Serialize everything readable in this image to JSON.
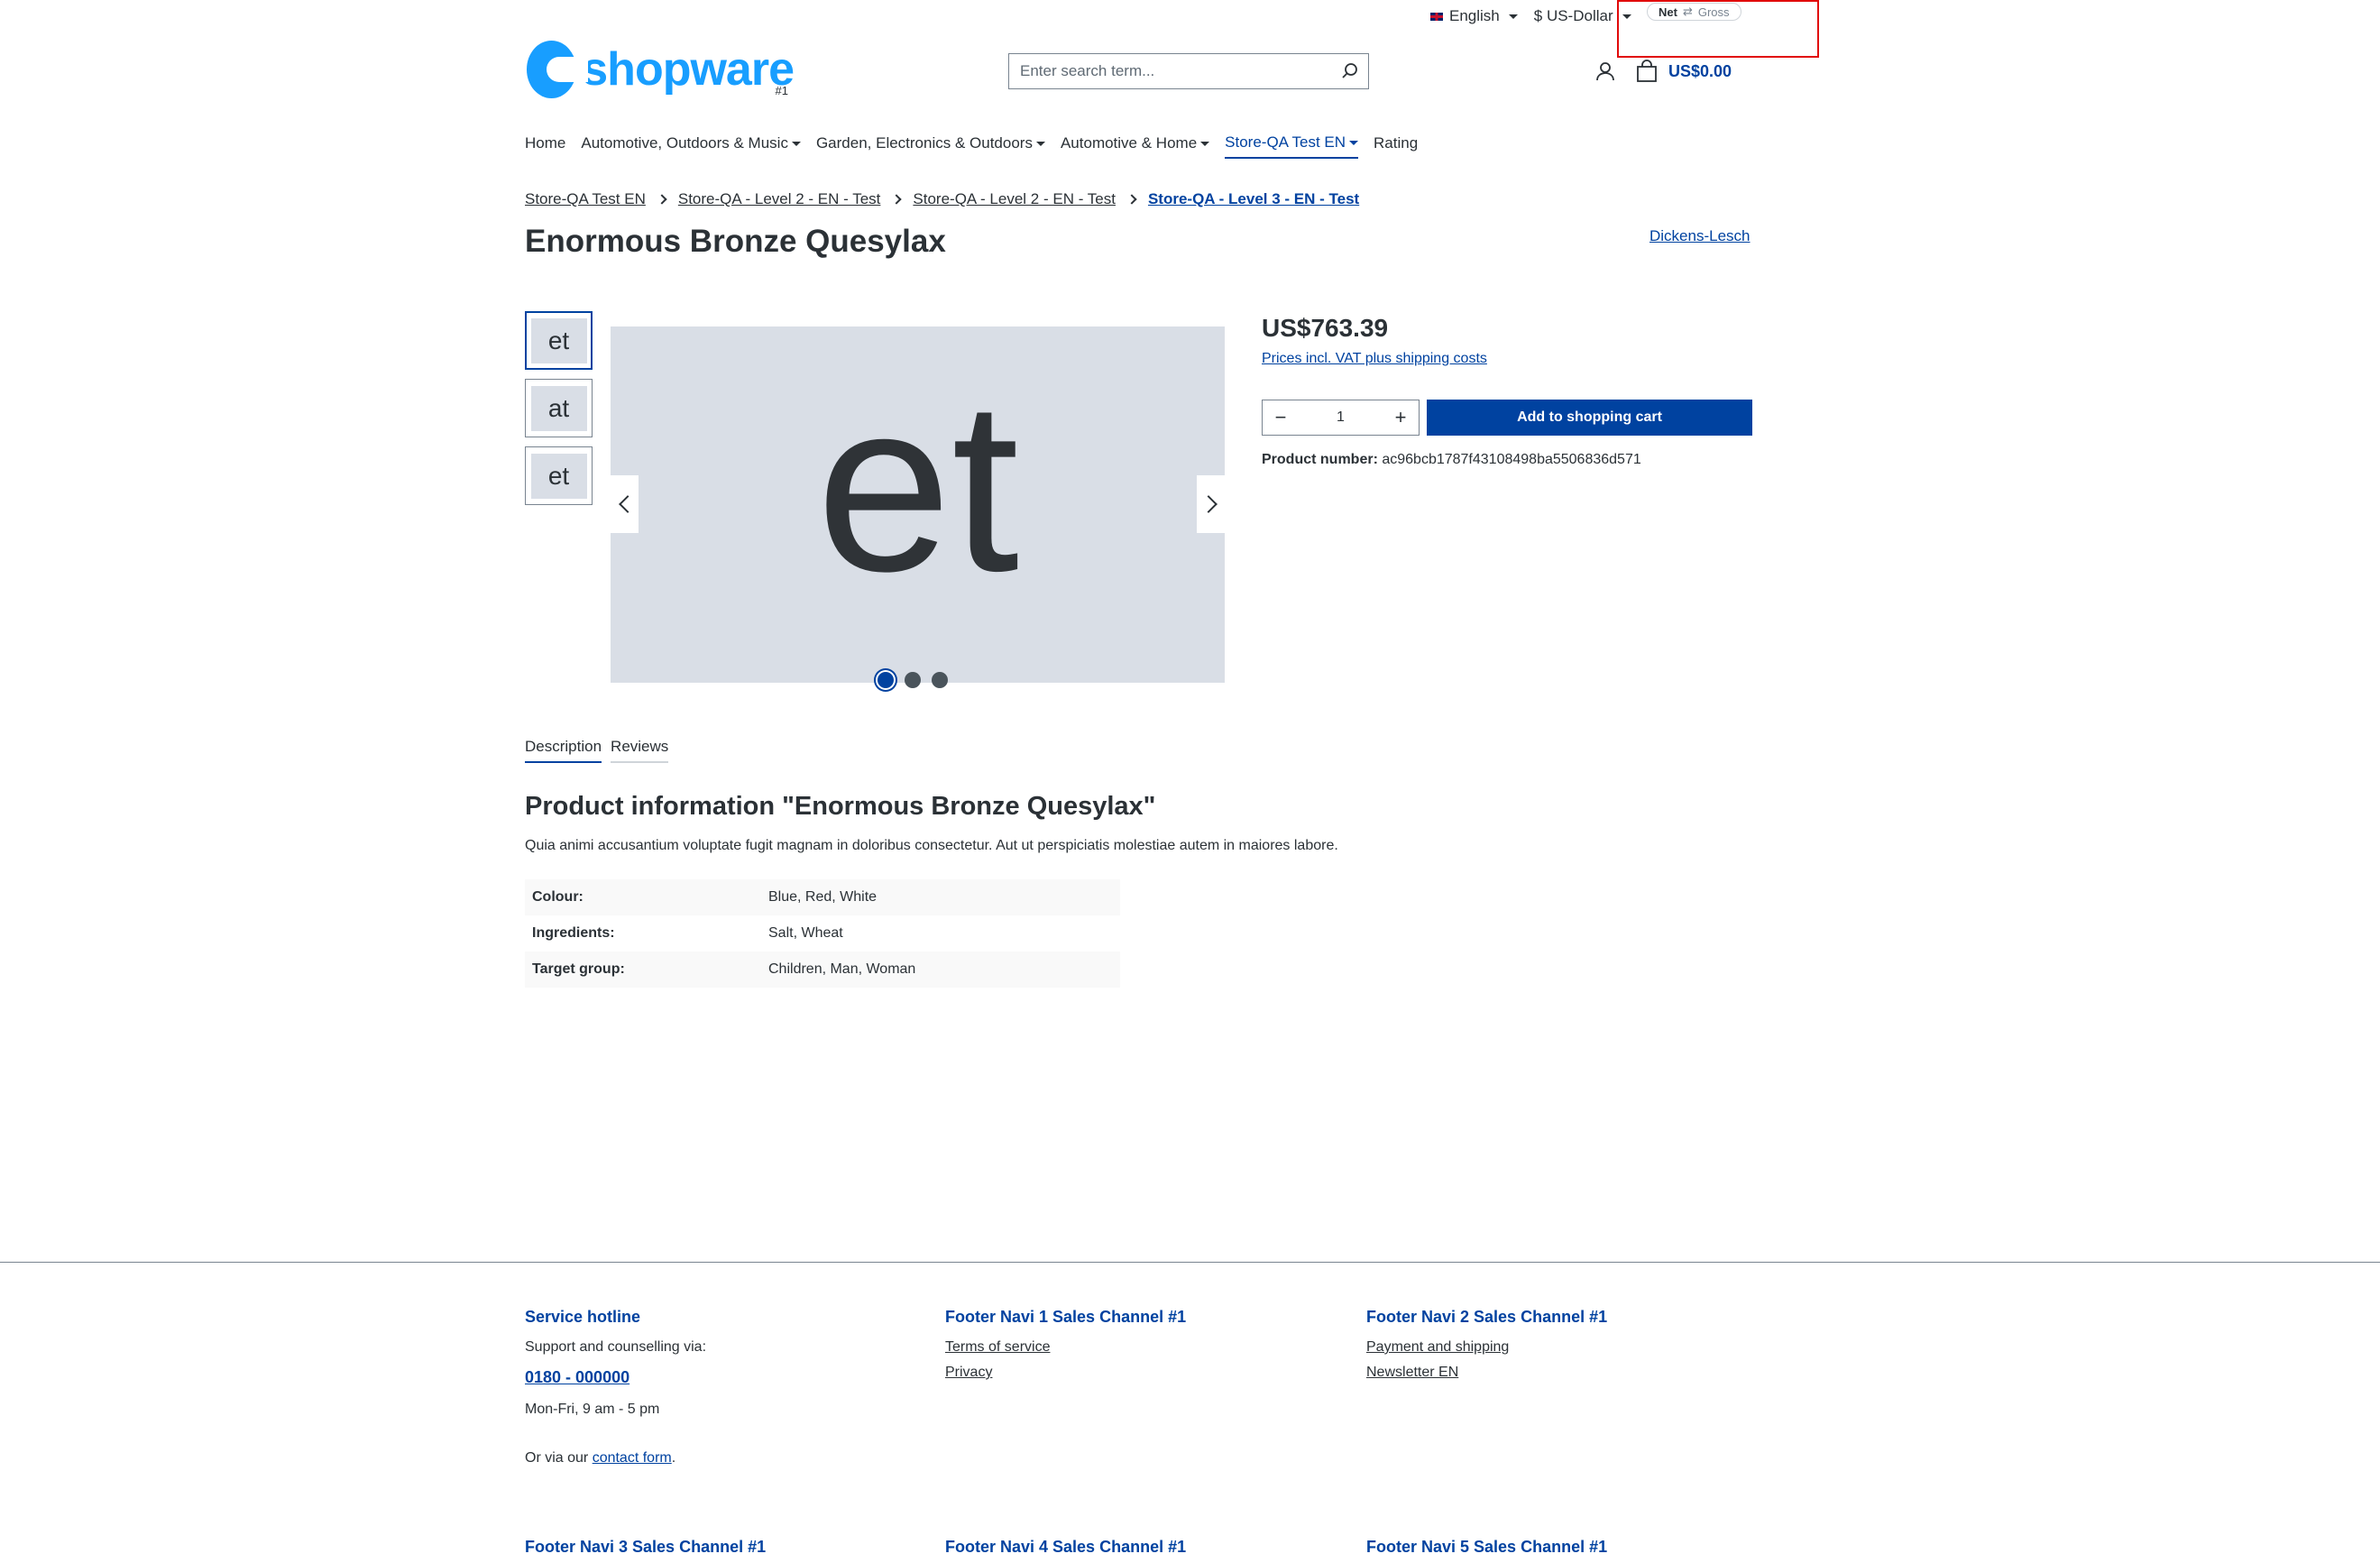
{
  "topbar": {
    "language": "English",
    "currency": "$ US-Dollar",
    "net_label": "Net",
    "gross_label": "Gross",
    "switch_glyph": "⇄"
  },
  "header": {
    "logo_text": "shopware",
    "logo_sub": "#1",
    "search_placeholder": "Enter search term...",
    "cart_amount": "US$0.00"
  },
  "nav": {
    "items": [
      {
        "label": "Home"
      },
      {
        "label": "Automotive, Outdoors & Music"
      },
      {
        "label": "Garden, Electronics & Outdoors"
      },
      {
        "label": "Automotive & Home"
      },
      {
        "label": "Store-QA Test EN"
      },
      {
        "label": "Rating"
      }
    ]
  },
  "breadcrumb": [
    "Store-QA Test EN",
    "Store-QA - Level 2 - EN - Test",
    "Store-QA - Level 2 - EN - Test",
    "Store-QA - Level 3 - EN - Test"
  ],
  "product": {
    "title": "Enormous Bronze Quesylax",
    "manufacturer": "Dickens-Lesch",
    "thumbnails": [
      "et",
      "at",
      "et"
    ],
    "main_image_text": "et",
    "price": "US$763.39",
    "vat_note": "Prices incl. VAT plus shipping costs",
    "quantity": "1",
    "add_to_cart": "Add to shopping cart",
    "number_label": "Product number:",
    "number_value": "ac96bcb1787f43108498ba5506836d571"
  },
  "tabs": [
    "Description",
    "Reviews"
  ],
  "description": {
    "title": "Product information \"Enormous Bronze Quesylax\"",
    "text": "Quia animi accusantium voluptate fugit magnam in doloribus consectetur. Aut ut perspiciatis molestiae autem in maiores labore.",
    "properties": [
      {
        "key": "Colour:",
        "value": "Blue, Red, White"
      },
      {
        "key": "Ingredients:",
        "value": "Salt, Wheat"
      },
      {
        "key": "Target group:",
        "value": "Children, Man, Woman"
      }
    ]
  },
  "footer": {
    "hotline": {
      "title": "Service hotline",
      "support": "Support and counselling via:",
      "phone": "0180 - 000000",
      "hours": "Mon-Fri, 9 am - 5 pm",
      "contact_prefix": "Or via our ",
      "contact_link": "contact form",
      "contact_suffix": "."
    },
    "navi1": {
      "title": "Footer Navi 1 Sales Channel #1",
      "links": [
        "Terms of service",
        "Privacy"
      ]
    },
    "navi2": {
      "title": "Footer Navi 2 Sales Channel #1",
      "links": [
        "Payment and shipping",
        "Newsletter EN"
      ]
    },
    "navi3": "Footer Navi 3 Sales Channel #1",
    "navi4": "Footer Navi 4 Sales Channel #1",
    "navi5": "Footer Navi 5 Sales Channel #1"
  },
  "colors": {
    "brand_blue": "#0042a0",
    "logo_blue": "#189eff",
    "highlight_red": "#e10a0a",
    "image_bg": "#d9dee6"
  }
}
